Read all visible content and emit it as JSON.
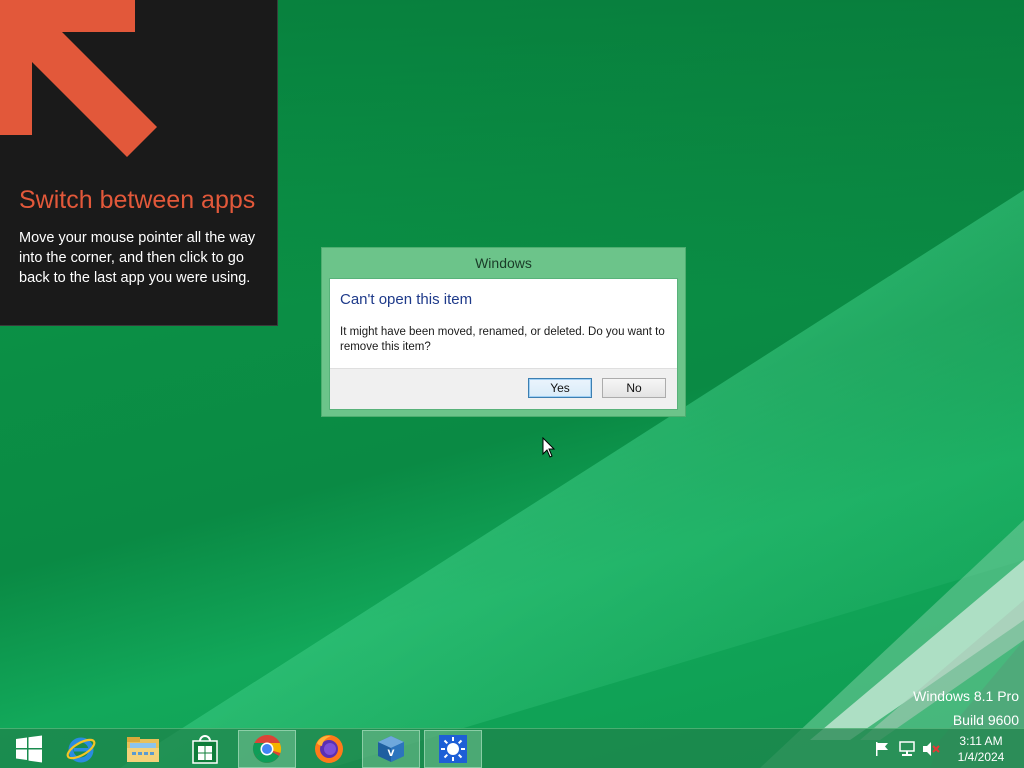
{
  "tip": {
    "title": "Switch between apps",
    "body": "Move your mouse pointer all the way into the corner, and then click to go back to the last app you were using."
  },
  "dialog": {
    "window_title": "Windows",
    "heading": "Can't open this item",
    "message": "It might have been moved, renamed, or deleted. Do you want to remove this item?",
    "yes_label": "Yes",
    "no_label": "No"
  },
  "watermark": {
    "line1": "Windows 8.1 Pro",
    "line2": "Build 9600"
  },
  "taskbar": {
    "items": [
      {
        "name": "start-button",
        "icon": "windows-logo-icon"
      },
      {
        "name": "internet-explorer",
        "icon": "internet-explorer-icon"
      },
      {
        "name": "file-explorer",
        "icon": "folder-icon"
      },
      {
        "name": "store",
        "icon": "store-bag-icon"
      },
      {
        "name": "chrome",
        "icon": "chrome-icon"
      },
      {
        "name": "firefox",
        "icon": "firefox-icon"
      },
      {
        "name": "virtualbox",
        "icon": "virtualbox-icon"
      },
      {
        "name": "unknown-app",
        "icon": "sun-icon"
      }
    ],
    "tray": {
      "icons": [
        "flag-icon",
        "network-icon",
        "speaker-muted-icon"
      ],
      "time": "3:11 AM",
      "date": "1/4/2024"
    }
  },
  "colors": {
    "tip_accent": "#e2583a",
    "dialog_heading": "#1e3a8a",
    "desktop_green": "#0b8f45"
  }
}
